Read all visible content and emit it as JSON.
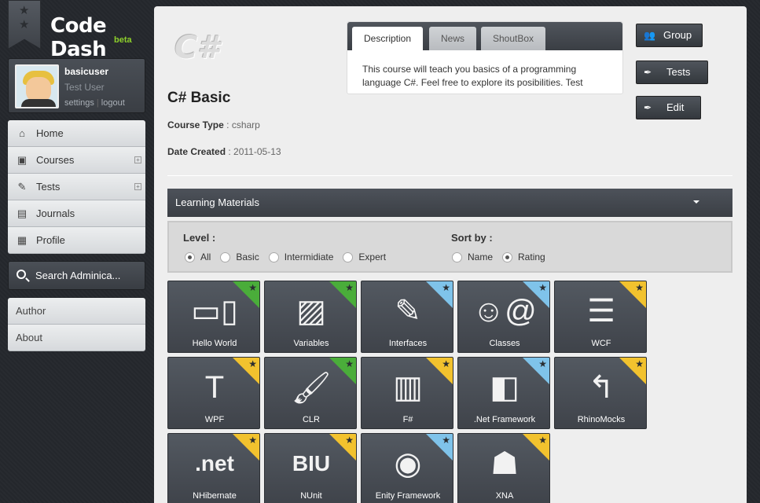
{
  "app": {
    "logo_text": "Code Dash",
    "logo_badge": "beta"
  },
  "user": {
    "username": "basicuser",
    "full_name": "Test User",
    "settings_label": "settings",
    "logout_label": "logout"
  },
  "nav": [
    {
      "label": "Home",
      "icon": "home-icon",
      "glyph": "⌂",
      "expandable": false
    },
    {
      "label": "Courses",
      "icon": "courses-icon",
      "glyph": "▣",
      "expandable": true
    },
    {
      "label": "Tests",
      "icon": "tests-icon",
      "glyph": "✎",
      "expandable": true
    },
    {
      "label": "Journals",
      "icon": "journals-icon",
      "glyph": "▤",
      "expandable": false
    },
    {
      "label": "Profile",
      "icon": "profile-icon",
      "glyph": "▦",
      "expandable": false
    }
  ],
  "search": {
    "placeholder": "Search Adminica..."
  },
  "nav2": [
    {
      "label": "Author"
    },
    {
      "label": "About"
    }
  ],
  "course": {
    "logo_text": "C#",
    "title": "C# Basic",
    "type_label": "Course Type",
    "type_value": "csharp",
    "date_label": "Date Created",
    "date_value": "2011-05-13"
  },
  "tabs": {
    "items": [
      {
        "label": "Description",
        "active": true
      },
      {
        "label": "News",
        "active": false
      },
      {
        "label": "ShoutBox",
        "active": false
      }
    ],
    "description": "This course will teach you basics of a programming language C#. Feel free to explore its posibilities. Test"
  },
  "actions": {
    "group": "Group",
    "tests": "Tests",
    "edit": "Edit"
  },
  "learning_materials": {
    "title": "Learning Materials",
    "level_label": "Level :",
    "levels": [
      {
        "label": "All",
        "selected": true
      },
      {
        "label": "Basic",
        "selected": false
      },
      {
        "label": "Intermidiate",
        "selected": false
      },
      {
        "label": "Expert",
        "selected": false
      }
    ],
    "sort_label": "Sort by :",
    "sorts": [
      {
        "label": "Name",
        "selected": false
      },
      {
        "label": "Rating",
        "selected": true
      }
    ]
  },
  "colors": {
    "green": "#4aad3a",
    "blue": "#7fc3ea",
    "yellow": "#f2c22e"
  },
  "materials": [
    {
      "label": "Hello World",
      "level": "green",
      "icon": "devices-icon",
      "glyph": "▭▯"
    },
    {
      "label": "Variables",
      "level": "green",
      "icon": "image-icon",
      "glyph": "▨"
    },
    {
      "label": "Interfaces",
      "level": "blue",
      "icon": "pencil-icon",
      "glyph": "✎"
    },
    {
      "label": "Classes",
      "level": "blue",
      "icon": "contact-card-icon",
      "glyph": "☺@"
    },
    {
      "label": "WCF",
      "level": "yellow",
      "icon": "list-icon",
      "glyph": "☰"
    },
    {
      "label": "WPF",
      "level": "yellow",
      "icon": "text-icon",
      "glyph": "T"
    },
    {
      "label": "CLR",
      "level": "green",
      "icon": "brush-icon",
      "glyph": "🖌"
    },
    {
      "label": "F#",
      "level": "yellow",
      "icon": "map-icon",
      "glyph": "▥"
    },
    {
      "label": ".Net Framework",
      "level": "blue",
      "icon": "layout-icon",
      "glyph": "◧"
    },
    {
      "label": "RhinoMocks",
      "level": "yellow",
      "icon": "arrow-up-left-icon",
      "glyph": "↰"
    },
    {
      "label": "NHibernate",
      "level": "yellow",
      "icon": "dotnet-icon",
      "glyph": ".net"
    },
    {
      "label": "NUnit",
      "level": "yellow",
      "icon": "text-format-icon",
      "glyph": "BIU"
    },
    {
      "label": "Enity Framework",
      "level": "blue",
      "icon": "keyhole-icon",
      "glyph": "◉"
    },
    {
      "label": "XNA",
      "level": "yellow",
      "icon": "android-icon",
      "glyph": "☗"
    }
  ]
}
